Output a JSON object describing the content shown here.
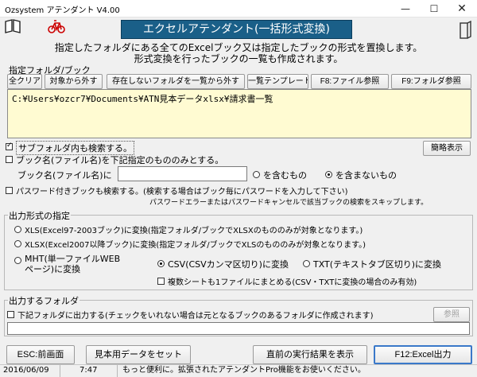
{
  "window": {
    "title": "Ozsystem アテンダント V4.00"
  },
  "banner": {
    "title": "エクセルアテンダント(一括形式変換)"
  },
  "description": {
    "line1": "指定したフォルダにある全てのExcelブック又は指定したブックの形式を置換します。",
    "line2": "形式変換を行ったブックの一覧も作成されます。"
  },
  "folder_section": {
    "label": "指定フォルダ/ブック",
    "buttons": {
      "clear": "全クリア",
      "exclude": "対象から外す",
      "remove_missing": "存在しないフォルダを一覧から外す",
      "list_template": "一覧テンプレート",
      "file_ref": "F8:ファイル参照",
      "folder_ref": "F9:フォルダ参照"
    },
    "path": "C:¥Users¥ozcr7¥Documents¥ATN見本データxlsx¥請求書一覧"
  },
  "subfolder_search": "サブフォルダ内も検索する。",
  "simple_view_button": "簡略表示",
  "bookname_filter": {
    "checkbox_label": "ブック名(ファイル名)を下記指定のもののみとする。",
    "field_label": "ブック名(ファイル名)に",
    "value": "",
    "include": "を含むもの",
    "exclude": "を含まないもの"
  },
  "password": {
    "label": "パスワード付きブックも検索する。(検索する場合はブック毎にパスワードを入力して下さい)",
    "note": "パスワードエラーまたはパスワードキャンセルで該当ブックの検索をスキップします。"
  },
  "output_format": {
    "label": "出力形式の指定",
    "xls": "XLS(Excel97-2003ブック)に変換(指定フォルダ/ブックでXLSXのもののみが対象となります。)",
    "xlsx": "XLSX(Excel2007以降ブック)に変換(指定フォルダ/ブックでXLSのもののみが対象となります。)",
    "mht_line1": "MHT(単一ファイルWEB",
    "mht_line2": "ページ)に変換",
    "csv": "CSV(CSVカンマ区切り)に変換",
    "txt": "TXT(テキストタブ区切り)に変換",
    "multi_sheet": "複数シートも1ファイルにまとめる(CSV・TXTに変換の場合のみ有効)"
  },
  "output_folder": {
    "label": "出力するフォルダ",
    "checkbox_label": "下記フォルダに出力する(チェックをいれない場合は元となるブックのあるフォルダに作成されます)",
    "ref_button": "参照",
    "value": ""
  },
  "bottom_buttons": {
    "esc": "ESC:前画面",
    "sample": "見本用データをセット",
    "last_result": "直前の実行結果を表示",
    "f12": "F12:Excel出力"
  },
  "status": {
    "date": "2016/06/09",
    "time": "7:47",
    "message": "もっと便利に。拡張されたアテンダントPro機能をお使いください。"
  },
  "colors": {
    "banner_bg": "#1a5f88",
    "path_bg": "#fffbd2",
    "focus": "#3a78c9"
  }
}
